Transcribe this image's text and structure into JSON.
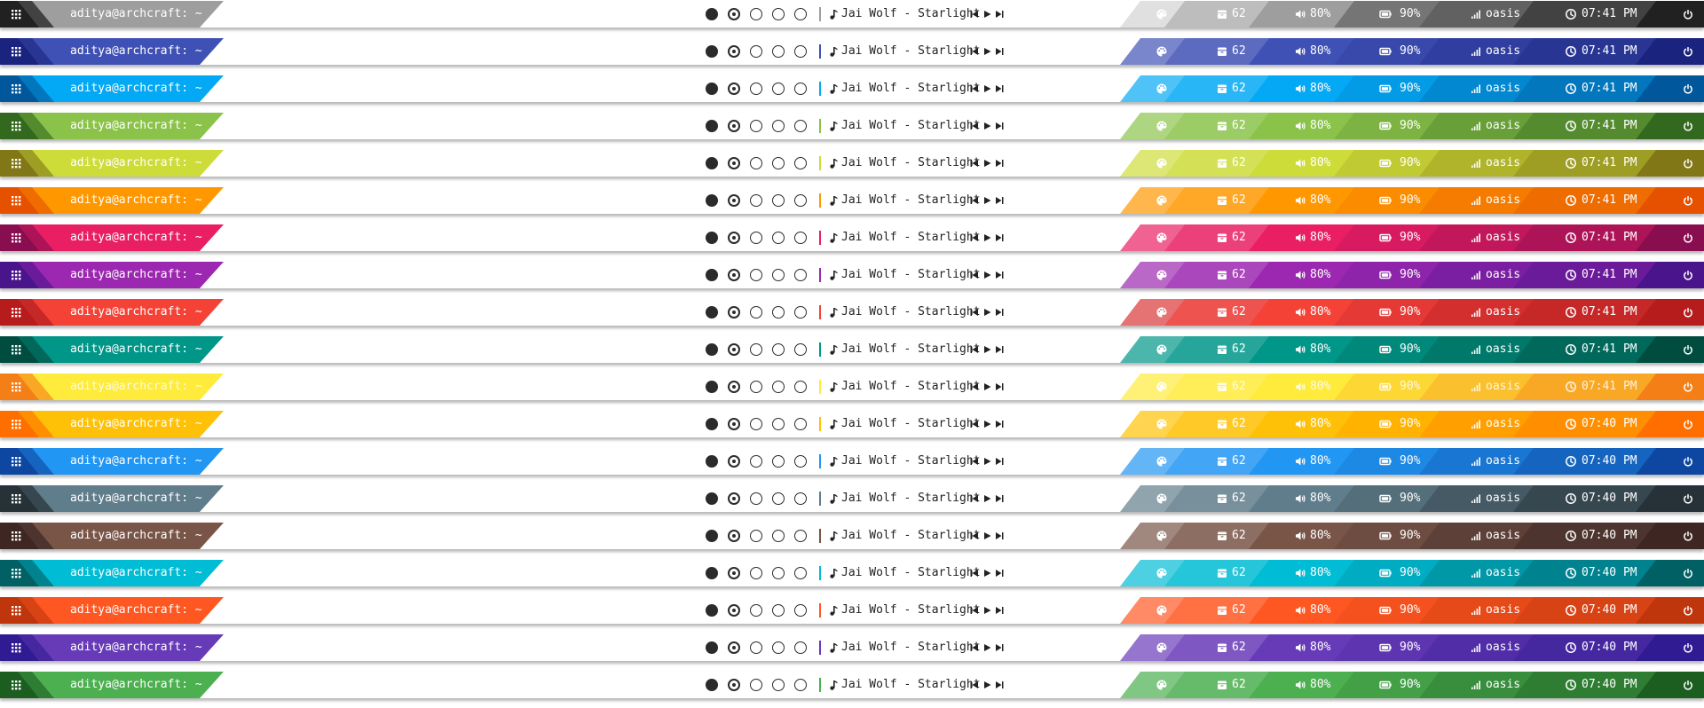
{
  "bar_common": {
    "terminal_title": "aditya@archcraft: ~",
    "now_playing": "Jai Wolf - Starlight",
    "updates_count": "62",
    "volume": "80%",
    "battery": "90%",
    "network": "oasis",
    "icons": {
      "menu": "grid-menu-icon",
      "music": "music-note-icon",
      "prev": "previous-track-icon",
      "play": "play-icon",
      "next": "next-track-icon",
      "theme": "palette-icon",
      "updates": "package-icon",
      "volume": "speaker-icon",
      "battery": "battery-icon",
      "network": "signal-icon",
      "clock": "clock-icon",
      "power": "power-icon"
    },
    "workspaces": [
      "occupied",
      "active",
      "empty",
      "empty",
      "empty"
    ]
  },
  "bars": [
    {
      "theme": "grey",
      "time": "07:41 PM",
      "c1": "#e0e0e0",
      "c2": "#bdbdbd",
      "c3": "#9e9e9e",
      "c4": "#757575",
      "c5": "#616161",
      "c6": "#424242",
      "c7": "#212121"
    },
    {
      "theme": "indigo",
      "time": "07:41 PM",
      "c1": "#7986cb",
      "c2": "#5c6bc0",
      "c3": "#3f51b5",
      "c4": "#3949ab",
      "c5": "#303f9f",
      "c6": "#283593",
      "c7": "#1a237e"
    },
    {
      "theme": "light-blue",
      "time": "07:41 PM",
      "c1": "#4fc3f7",
      "c2": "#29b6f6",
      "c3": "#03a9f4",
      "c4": "#039be5",
      "c5": "#0288d1",
      "c6": "#0277bd",
      "c7": "#01579b"
    },
    {
      "theme": "light-green",
      "time": "07:41 PM",
      "c1": "#aed581",
      "c2": "#9ccc65",
      "c3": "#8bc34a",
      "c4": "#7cb342",
      "c5": "#689f38",
      "c6": "#558b2f",
      "c7": "#33691e"
    },
    {
      "theme": "lime",
      "time": "07:41 PM",
      "c1": "#dce775",
      "c2": "#d4e157",
      "c3": "#cddc39",
      "c4": "#c0ca33",
      "c5": "#afb42b",
      "c6": "#9e9d24",
      "c7": "#827717"
    },
    {
      "theme": "orange",
      "time": "07:41 PM",
      "c1": "#ffb74d",
      "c2": "#ffa726",
      "c3": "#ff9800",
      "c4": "#fb8c00",
      "c5": "#f57c00",
      "c6": "#ef6c00",
      "c7": "#e65100"
    },
    {
      "theme": "pink",
      "time": "07:41 PM",
      "c1": "#f06292",
      "c2": "#ec407a",
      "c3": "#e91e63",
      "c4": "#d81b60",
      "c5": "#c2185b",
      "c6": "#ad1457",
      "c7": "#880e4f"
    },
    {
      "theme": "purple",
      "time": "07:41 PM",
      "c1": "#ba68c8",
      "c2": "#ab47bc",
      "c3": "#9c27b0",
      "c4": "#8e24aa",
      "c5": "#7b1fa2",
      "c6": "#6a1b9a",
      "c7": "#4a148c"
    },
    {
      "theme": "red",
      "time": "07:41 PM",
      "c1": "#e57373",
      "c2": "#ef5350",
      "c3": "#f44336",
      "c4": "#e53935",
      "c5": "#d32f2f",
      "c6": "#c62828",
      "c7": "#b71c1c"
    },
    {
      "theme": "teal",
      "time": "07:41 PM",
      "c1": "#4db6ac",
      "c2": "#26a69a",
      "c3": "#009688",
      "c4": "#00897b",
      "c5": "#00796b",
      "c6": "#00695c",
      "c7": "#004d40"
    },
    {
      "theme": "yellow",
      "time": "07:41 PM",
      "c1": "#fff176",
      "c2": "#ffee58",
      "c3": "#ffeb3b",
      "c4": "#fdd835",
      "c5": "#fbc02d",
      "c6": "#f9a825",
      "c7": "#f57f17"
    },
    {
      "theme": "amber",
      "time": "07:40 PM",
      "c1": "#ffd54f",
      "c2": "#ffca28",
      "c3": "#ffc107",
      "c4": "#ffb300",
      "c5": "#ffa000",
      "c6": "#ff8f00",
      "c7": "#ff6f00"
    },
    {
      "theme": "blue",
      "time": "07:40 PM",
      "c1": "#64b5f6",
      "c2": "#42a5f5",
      "c3": "#2196f3",
      "c4": "#1e88e5",
      "c5": "#1976d2",
      "c6": "#1565c0",
      "c7": "#0d47a1"
    },
    {
      "theme": "blue-grey",
      "time": "07:40 PM",
      "c1": "#90a4ae",
      "c2": "#78909c",
      "c3": "#607d8b",
      "c4": "#546e7a",
      "c5": "#455a64",
      "c6": "#37474f",
      "c7": "#263238"
    },
    {
      "theme": "brown",
      "time": "07:40 PM",
      "c1": "#a1887f",
      "c2": "#8d6e63",
      "c3": "#795548",
      "c4": "#6d4c41",
      "c5": "#5d4037",
      "c6": "#4e342e",
      "c7": "#3e2723"
    },
    {
      "theme": "cyan",
      "time": "07:40 PM",
      "c1": "#4dd0e1",
      "c2": "#26c6da",
      "c3": "#00bcd4",
      "c4": "#00acc1",
      "c5": "#0097a7",
      "c6": "#00838f",
      "c7": "#006064"
    },
    {
      "theme": "deep-orange",
      "time": "07:40 PM",
      "c1": "#ff8a65",
      "c2": "#ff7043",
      "c3": "#ff5722",
      "c4": "#f4511e",
      "c5": "#e64a19",
      "c6": "#d84315",
      "c7": "#bf360c"
    },
    {
      "theme": "deep-purple",
      "time": "07:40 PM",
      "c1": "#9575cd",
      "c2": "#7e57c2",
      "c3": "#673ab7",
      "c4": "#5e35b1",
      "c5": "#512da8",
      "c6": "#4527a0",
      "c7": "#311b92"
    },
    {
      "theme": "green",
      "time": "07:40 PM",
      "c1": "#81c784",
      "c2": "#66bb6a",
      "c3": "#4caf50",
      "c4": "#43a047",
      "c5": "#388e3c",
      "c6": "#2e7d32",
      "c7": "#1b5e20"
    }
  ]
}
